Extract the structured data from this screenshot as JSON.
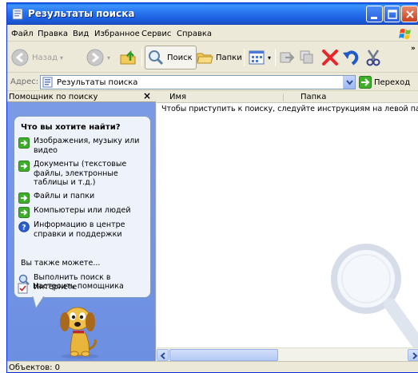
{
  "window": {
    "title": "Результаты поиска"
  },
  "menu": [
    "Файл",
    "Правка",
    "Вид",
    "Избранное",
    "Сервис",
    "Справка"
  ],
  "toolbar": {
    "back_label": "Назад",
    "search_label": "Поиск",
    "folders_label": "Папки"
  },
  "address": {
    "label": "Адрес:",
    "value": "Результаты поиска",
    "go_label": "Переход"
  },
  "assistant": {
    "header": "Помощник по поиску",
    "question": "Что вы хотите найти?",
    "options": [
      {
        "label": "Изображения, музыку или видео",
        "icon": "green-arrow-icon"
      },
      {
        "label": "Документы (текстовые файлы, электронные таблицы и т.д.)",
        "icon": "green-arrow-icon"
      },
      {
        "label": "Файлы и папки",
        "icon": "green-arrow-icon"
      },
      {
        "label": "Компьютеры или людей",
        "icon": "green-arrow-icon"
      },
      {
        "label": "Информацию в центре справки и поддержки",
        "icon": "help-icon"
      }
    ],
    "also_label": "Вы также можете...",
    "also_options": [
      {
        "label": "Выполнить поиск в Интернете",
        "icon": "internet-search-icon"
      },
      {
        "label": "Настроить помощника",
        "icon": "checklist-icon"
      }
    ]
  },
  "content": {
    "columns": [
      "Имя",
      "Папка"
    ],
    "hint": "Чтобы приступить к поиску, следуйте инструкциям на левой панели."
  },
  "status": {
    "text": "Объектов: 0"
  },
  "colors": {
    "titlebar": "#2a78f0",
    "assistant_bg": "#6d8fe2",
    "chrome": "#ece9d8"
  }
}
